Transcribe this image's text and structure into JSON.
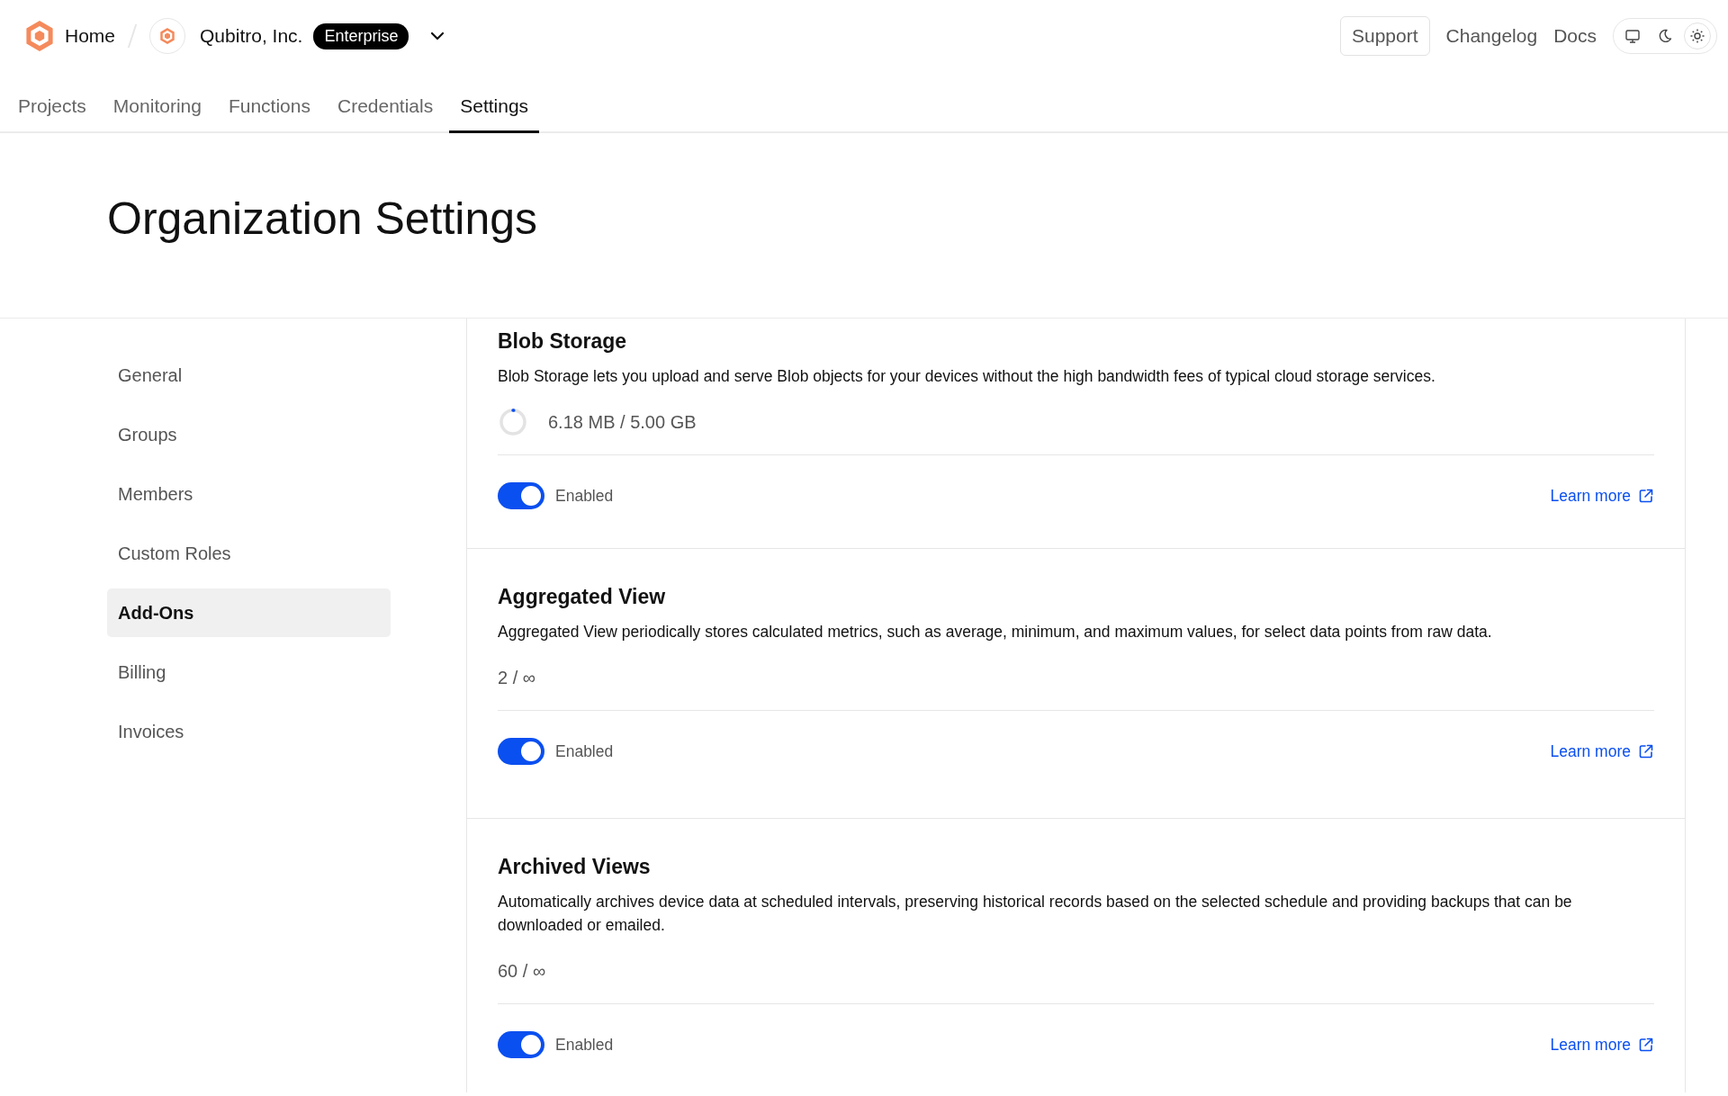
{
  "breadcrumb": {
    "home": "Home",
    "organization": "Qubitro, Inc.",
    "plan_badge": "Enterprise"
  },
  "header_links": [
    {
      "label": "Support",
      "kind": "outlined"
    },
    {
      "label": "Changelog",
      "kind": "plain"
    },
    {
      "label": "Docs",
      "kind": "plain"
    }
  ],
  "theme_modes": [
    {
      "kind": "system",
      "selected": false
    },
    {
      "kind": "dark",
      "selected": false
    },
    {
      "kind": "light",
      "selected": true
    }
  ],
  "tabs": [
    {
      "label": "Projects",
      "selected": false
    },
    {
      "label": "Monitoring",
      "selected": false
    },
    {
      "label": "Functions",
      "selected": false
    },
    {
      "label": "Credentials",
      "selected": false
    },
    {
      "label": "Settings",
      "selected": true
    }
  ],
  "page_title": "Organization Settings",
  "sidebar": {
    "items": [
      {
        "label": "General",
        "selected": false
      },
      {
        "label": "Groups",
        "selected": false
      },
      {
        "label": "Members",
        "selected": false
      },
      {
        "label": "Custom Roles",
        "selected": false
      },
      {
        "label": "Add-Ons",
        "selected": true
      },
      {
        "label": "Billing",
        "selected": false
      },
      {
        "label": "Invoices",
        "selected": false
      }
    ]
  },
  "addons": [
    {
      "title": "Blob Storage",
      "description": "Blob Storage lets you upload and serve Blob objects for your devices without the high bandwidth fees of typical cloud storage services.",
      "usage": {
        "kind": "storage",
        "text": "6.18 MB / 5.00 GB",
        "level": 0.01
      },
      "enabled": true,
      "toggle_label": "Enabled",
      "link": "Learn more"
    },
    {
      "title": "Aggregated View",
      "description": "Aggregated View periodically stores calculated metrics, such as average, minimum, and maximum values, for select data points from raw data.",
      "usage": {
        "kind": "count",
        "text": "2 / ∞"
      },
      "enabled": true,
      "toggle_label": "Enabled",
      "link": "Learn more"
    },
    {
      "title": "Archived Views",
      "description": "Automatically archives device data at scheduled intervals, preserving historical records based on the selected schedule and providing backups that can be downloaded or emailed.",
      "usage": {
        "kind": "count",
        "text": "60 / ∞"
      },
      "enabled": true,
      "toggle_label": "Enabled",
      "link": "Learn more"
    }
  ]
}
